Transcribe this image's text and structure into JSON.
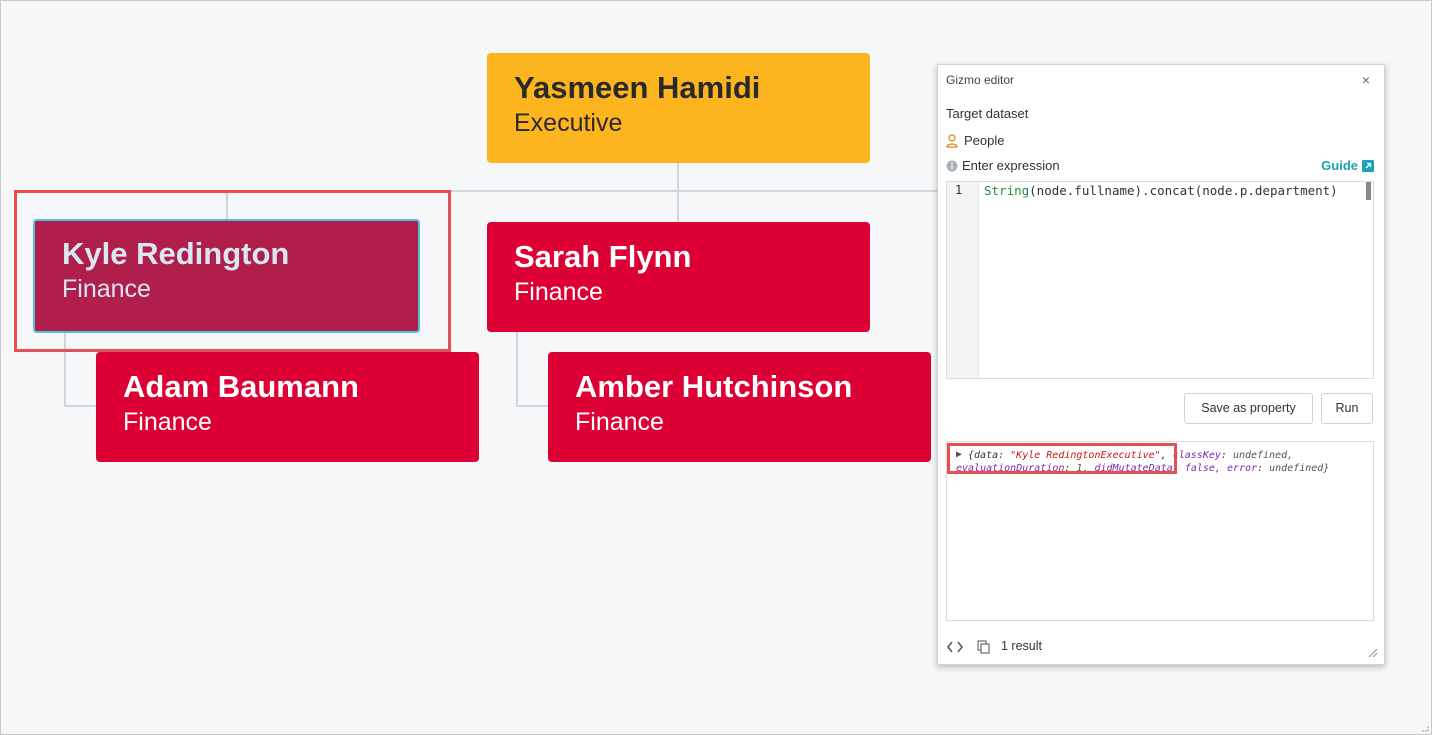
{
  "org": {
    "root": {
      "name": "Yasmeen Hamidi",
      "dept": "Executive"
    },
    "selected": {
      "name": "Kyle Redington",
      "dept": "Finance"
    },
    "n2": {
      "name": "Sarah Flynn",
      "dept": "Finance"
    },
    "n3": {
      "name": "Adam Baumann",
      "dept": "Finance"
    },
    "n4": {
      "name": "Amber Hutchinson",
      "dept": "Finance"
    }
  },
  "gizmo": {
    "title": "Gizmo editor",
    "close": "×",
    "target_label": "Target dataset",
    "dataset": "People",
    "expr_label": "Enter expression",
    "guide": "Guide",
    "line_number": "1",
    "code_fn": "String",
    "code_rest": "(node.fullname).concat(node.p.department)",
    "save_label": "Save as property",
    "run_label": "Run",
    "out": {
      "line1_open": "{data: ",
      "data_value": "\"Kyle RedingtonExecutive\"",
      "line1_key": "classKey",
      "line1_val": "undefined,",
      "line2_key": "evaluationDuration",
      "line2_val": "1,",
      "line2_key2": "didMutateData",
      "line2_val2": "false,",
      "line2_key3": "error",
      "line2_val3": "undefined}"
    },
    "result_count": "1 result"
  }
}
